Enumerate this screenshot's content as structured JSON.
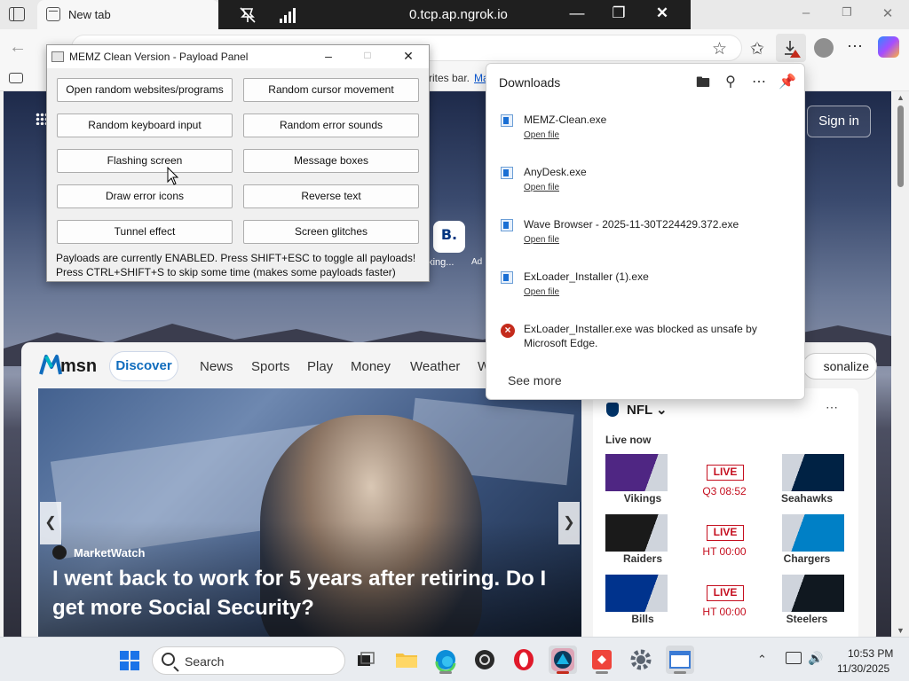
{
  "browser": {
    "tab_title": "New tab",
    "favorites_bar_text": "rites bar.",
    "favorites_bar_link": "Ma"
  },
  "ngrok": {
    "url": "0.tcp.ap.ngrok.io"
  },
  "memz": {
    "title": "MEMZ Clean Version - Payload Panel",
    "buttons": [
      "Open random websites/programs",
      "Random cursor movement",
      "Random keyboard input",
      "Random error sounds",
      "Flashing screen",
      "Message boxes",
      "Draw error icons",
      "Reverse text",
      "Tunnel effect",
      "Screen glitches"
    ],
    "status_line1": "Payloads are currently ENABLED. Press SHIFT+ESC to toggle all payloads!",
    "status_line2": "Press CTRL+SHIFT+S to skip some time (makes some payloads faster)"
  },
  "downloads": {
    "title": "Downloads",
    "items": [
      {
        "name": "MEMZ-Clean.exe",
        "action": "Open file"
      },
      {
        "name": "AnyDesk.exe",
        "action": "Open file"
      },
      {
        "name": "Wave Browser - 2025-11-30T224429.372.exe",
        "action": "Open file"
      },
      {
        "name": "ExLoader_Installer (1).exe",
        "action": "Open file"
      }
    ],
    "blocked": "ExLoader_Installer.exe was blocked as unsafe by Microsoft Edge.",
    "see_more": "See more"
  },
  "page": {
    "sign_in": "Sign in",
    "shortcut_letter": "B.",
    "shortcut_label": "oking...",
    "shortcut_ad": "Ad"
  },
  "msn": {
    "logo": "msn",
    "tabs": [
      "Discover",
      "News",
      "Sports",
      "Play",
      "Money",
      "Weather",
      "W"
    ],
    "personalize": "sonalize",
    "hero": {
      "source": "MarketWatch",
      "headline": "I went back to work for 5 years after retiring. Do I get more Social Security?"
    },
    "nfl": {
      "title": "NFL",
      "live_now": "Live now",
      "games": [
        {
          "home": "Vikings",
          "away": "Seahawks",
          "status": "LIVE",
          "time": "Q3 08:52",
          "home_color": "#4f2683",
          "away_color": "#002244"
        },
        {
          "home": "Raiders",
          "away": "Chargers",
          "status": "LIVE",
          "time": "HT 00:00",
          "home_color": "#1a1a1a",
          "away_color": "#0080c6"
        },
        {
          "home": "Bills",
          "away": "Steelers",
          "status": "LIVE",
          "time": "HT 00:00",
          "home_color": "#00338d",
          "away_color": "#101820"
        }
      ]
    }
  },
  "taskbar": {
    "search_placeholder": "Search",
    "time": "10:53 PM",
    "date": "11/30/2025"
  }
}
